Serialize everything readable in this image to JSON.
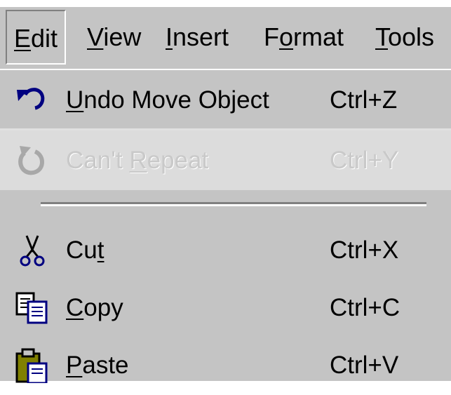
{
  "menubar": {
    "items": [
      {
        "label": "Edit",
        "mnemonic": "E",
        "rest": "dit",
        "active": true
      },
      {
        "label": "View",
        "mnemonic": "V",
        "rest": "iew"
      },
      {
        "label": "Insert",
        "mnemonic": "I",
        "rest": "nsert"
      },
      {
        "label": "Format",
        "pre": "F",
        "mnemonic": "o",
        "rest": "rmat"
      },
      {
        "label": "Tools",
        "mnemonic": "T",
        "rest": "ools"
      }
    ]
  },
  "dropdown": {
    "items": [
      {
        "pre": "",
        "mnemonic": "U",
        "rest": "ndo Move Object",
        "shortcut": "Ctrl+Z",
        "icon": "undo-icon",
        "enabled": true
      },
      {
        "pre": "Can't ",
        "mnemonic": "R",
        "rest": "epeat",
        "shortcut": "Ctrl+Y",
        "icon": "repeat-icon",
        "enabled": false
      },
      {
        "pre": "Cu",
        "mnemonic": "t",
        "rest": "",
        "shortcut": "Ctrl+X",
        "icon": "scissors-icon",
        "enabled": true
      },
      {
        "pre": "",
        "mnemonic": "C",
        "rest": "opy",
        "shortcut": "Ctrl+C",
        "icon": "copy-icon",
        "enabled": true
      },
      {
        "pre": "",
        "mnemonic": "P",
        "rest": "aste",
        "shortcut": "Ctrl+V",
        "icon": "paste-icon",
        "enabled": true
      }
    ]
  },
  "colors": {
    "menu_bg": "#c4c4c4",
    "disabled_row_bg": "#dcdcdc",
    "disabled_text": "#c9c9c9",
    "icon_blue": "#000080"
  }
}
